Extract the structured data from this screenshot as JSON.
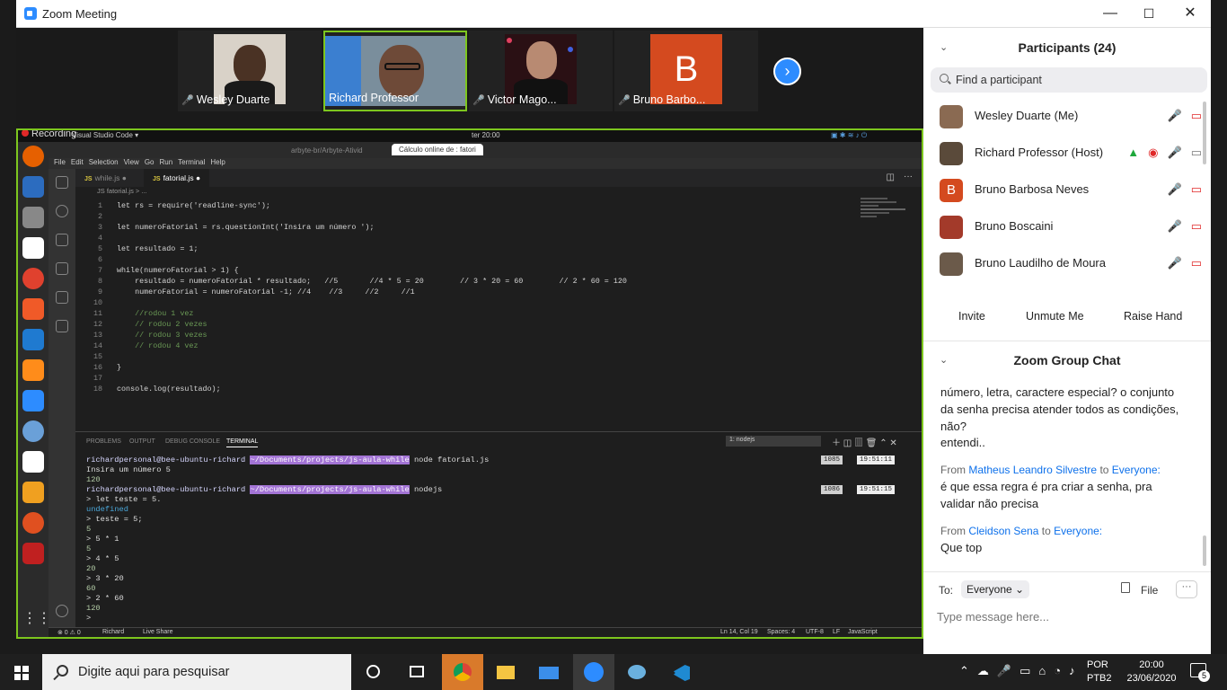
{
  "window": {
    "title": "Zoom Meeting",
    "min": "—",
    "max": "☐",
    "close": "✕"
  },
  "videos": [
    {
      "name": "Wesley Duarte",
      "muted": true
    },
    {
      "name": "Richard Professor",
      "muted": false
    },
    {
      "name": "Victor Mago...",
      "muted": true
    },
    {
      "name": "Bruno Barbo...",
      "muted": true,
      "initial": "B"
    }
  ],
  "next_arrow": "›",
  "share": {
    "recording": "Recording",
    "activities": "Activities",
    "app_menu": "Visual Studio Code ▾",
    "clock": "ter 20:00",
    "browser_tabs": [
      "arbyte-br/Arbyte-Ativid",
      "Cálculo online de : fatori"
    ],
    "menus": [
      "File",
      "Edit",
      "Selection",
      "View",
      "Go",
      "Run",
      "Terminal",
      "Help"
    ],
    "editor_tabs": [
      {
        "name": "while.js",
        "active": false
      },
      {
        "name": "fatorial.js",
        "active": true
      }
    ],
    "breadcrumb": "JS fatorial.js > ...",
    "code_lines": [
      "let rs = require('readline-sync');",
      "",
      "let numeroFatorial = rs.questionInt('Insira um número ');",
      "",
      "let resultado = 1;",
      "",
      "while(numeroFatorial > 1) {",
      "    resultado = numeroFatorial * resultado;   //5       //4 * 5 = 20        // 3 * 20 = 60        // 2 * 60 = 120",
      "    numeroFatorial = numeroFatorial -1; //4    //3     //2     //1",
      "",
      "    //rodou 1 vez",
      "    // rodou 2 vezes",
      "    // rodou 3 vezes",
      "    // rodou 4 vez",
      "",
      "}",
      "",
      "console.log(resultado);"
    ],
    "panel_tabs": [
      "PROBLEMS",
      "OUTPUT",
      "DEBUG CONSOLE",
      "TERMINAL"
    ],
    "terminal_select": "1: nodejs",
    "prompt_user": "richardpersonal@bee-ubuntu-richard",
    "prompt_path": "~/Documents/projects/js-aula-while",
    "cmd1": "node fatorial.js",
    "cmd2": "nodejs",
    "badge1_num": "1085",
    "badge1_time": "19:51:11",
    "badge2_num": "1086",
    "badge2_time": "19:51:15",
    "terminal_lines": [
      "Insira um número 5",
      "120",
      "",
      "> let teste = 5.",
      "undefined",
      "> teste = 5;",
      "5",
      "> 5 * 1",
      "5",
      "> 4 * 5",
      "20",
      "> 3 * 20",
      "60",
      "> 2 * 60",
      "120",
      "> "
    ],
    "status_left": "⊗ 0 ⚠ 0",
    "status_user": "Richard",
    "status_share": "Live Share",
    "status_right": [
      "Ln 14, Col 19",
      "Spaces: 4",
      "UTF-8",
      "LF",
      "JavaScript"
    ]
  },
  "participants": {
    "title": "Participants (24)",
    "search_placeholder": "Find a participant",
    "list": [
      {
        "name": "Wesley Duarte (Me)",
        "color": "#8a6a52"
      },
      {
        "name": "Richard Professor (Host)",
        "color": "#5a4a3a"
      },
      {
        "name": "Bruno Barbosa Neves",
        "color": "#d44a1f",
        "initial": "B"
      },
      {
        "name": "Bruno Boscaini",
        "color": "#a33a2a"
      },
      {
        "name": "Bruno Laudilho de Moura",
        "color": "#6b5a4a"
      }
    ],
    "buttons": [
      "Invite",
      "Unmute Me",
      "Raise Hand"
    ]
  },
  "chat": {
    "title": "Zoom Group Chat",
    "msg0": "número, letra, caractere especial? o conjunto da senha precisa atender todos as condições, não?",
    "msg0b": "entendi..",
    "from1": "From",
    "sender1": "Matheus Leandro Silvestre",
    "to1": "to",
    "target1": "Everyone:",
    "msg1": "é que essa regra é pra criar a senha, pra validar não precisa",
    "from2": "From",
    "sender2": "Cleidson Sena",
    "to2": "to",
    "target2": "Everyone:",
    "msg2": "Que top",
    "to_label": "To:",
    "to_value": "Everyone ⌄",
    "file": "File",
    "more": "···",
    "input_placeholder": "Type message here..."
  },
  "taskbar": {
    "search_placeholder": "Digite aqui para pesquisar",
    "lang1": "POR",
    "lang2": "PTB2",
    "time": "20:00",
    "date": "23/06/2020",
    "notif": "5"
  }
}
